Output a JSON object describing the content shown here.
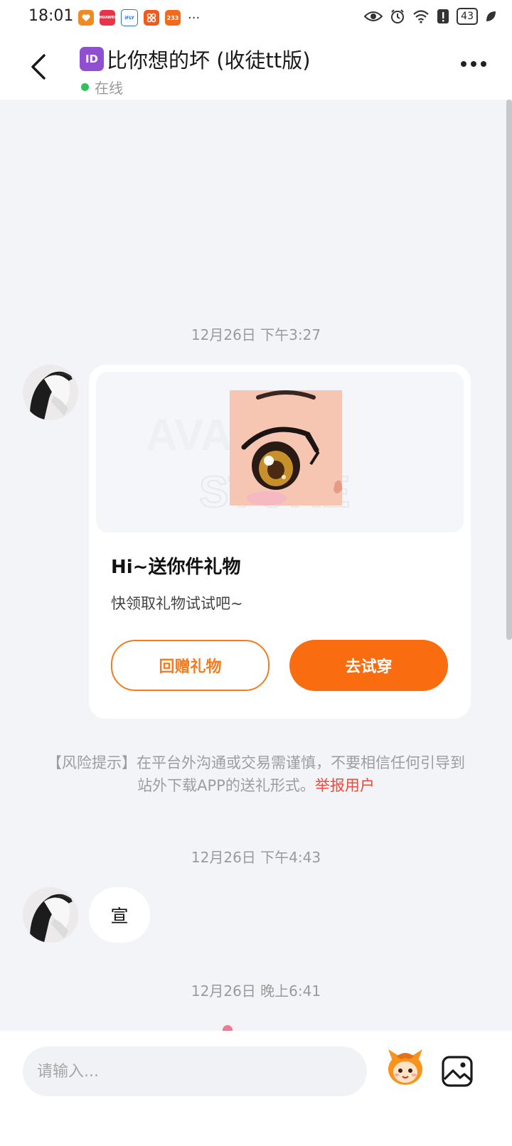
{
  "status_bar": {
    "time": "18:01",
    "battery": "43",
    "more": "···",
    "app_badges": [
      "HUAWEI",
      "iFLY",
      "233"
    ]
  },
  "header": {
    "badge": "ID",
    "title": "比你想的坏 (收徒tt版)",
    "online_status": "在线"
  },
  "messages": {
    "timestamp_1": "12月26日 下午3:27",
    "gift_card": {
      "title": "Hi~送你件礼物",
      "subtitle": "快领取礼物试试吧~",
      "return_gift_label": "回赠礼物",
      "try_on_label": "去试穿"
    },
    "risk_notice": {
      "text": "【风险提示】在平台外沟通或交易需谨慎，不要相信任何引导到站外下载APP的送礼形式。",
      "report_link": "举报用户"
    },
    "timestamp_2": "12月26日 下午4:43",
    "message_text": "宣",
    "timestamp_3": "12月26日 晚上6:41"
  },
  "input_bar": {
    "placeholder": "请输入..."
  },
  "colors": {
    "accent": "#f96c10",
    "link": "#f0483c",
    "online": "#2fc25b",
    "background": "#f3f4f8"
  }
}
